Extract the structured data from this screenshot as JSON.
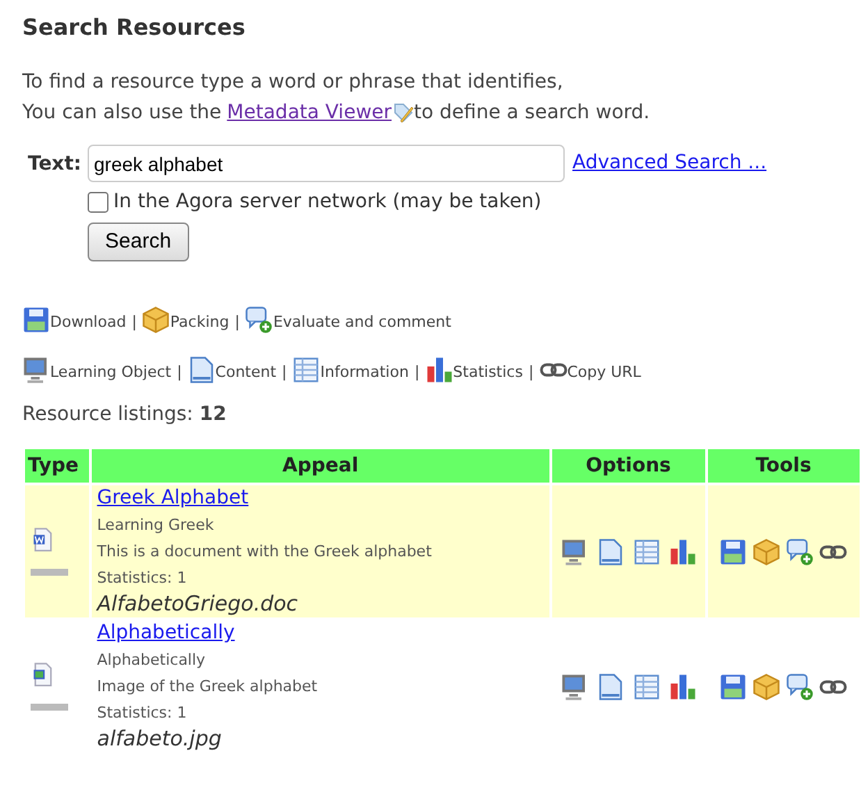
{
  "title": "Search Resources",
  "intro": {
    "line1": "To find a resource type a word or phrase that identifies,",
    "line2_before": "You can also use the",
    "link": "Metadata Viewer",
    "line2_after": "to define a search word."
  },
  "search": {
    "label": "Text:",
    "value": "greek alphabet",
    "advanced_link": "Advanced Search ...",
    "network_checkbox": {
      "label": "In the Agora server network (may be taken)",
      "checked": false
    },
    "button": "Search"
  },
  "legend_tools": [
    {
      "label": "Download",
      "separator": "|"
    },
    {
      "label": "Packing",
      "separator": "|"
    },
    {
      "label": "Evaluate and comment"
    }
  ],
  "legend_options": [
    {
      "label": "Learning Object",
      "separator": "|"
    },
    {
      "label": "Content",
      "separator": "|"
    },
    {
      "label": "Information",
      "separator": "|"
    },
    {
      "label": "Statistics",
      "separator": "|"
    },
    {
      "label": "Copy URL"
    }
  ],
  "listings": {
    "label": "Resource listings:",
    "count": "12"
  },
  "table": {
    "columns": [
      "Type",
      "Appeal",
      "Options",
      "Tools"
    ],
    "rows": [
      {
        "kind": "document",
        "highlighted": true,
        "title": "Greek Alphabet",
        "subtitle": "Learning Greek",
        "description": "This is a document with the Greek alphabet",
        "statistics": "Statistics: 1",
        "file": "AlfabetoGriego.doc"
      },
      {
        "kind": "image",
        "highlighted": false,
        "title": "Alphabetically",
        "subtitle": "Alphabetically",
        "description": "Image of the Greek alphabet",
        "statistics": "Statistics: 1",
        "file": "alfabeto.jpg"
      }
    ]
  }
}
